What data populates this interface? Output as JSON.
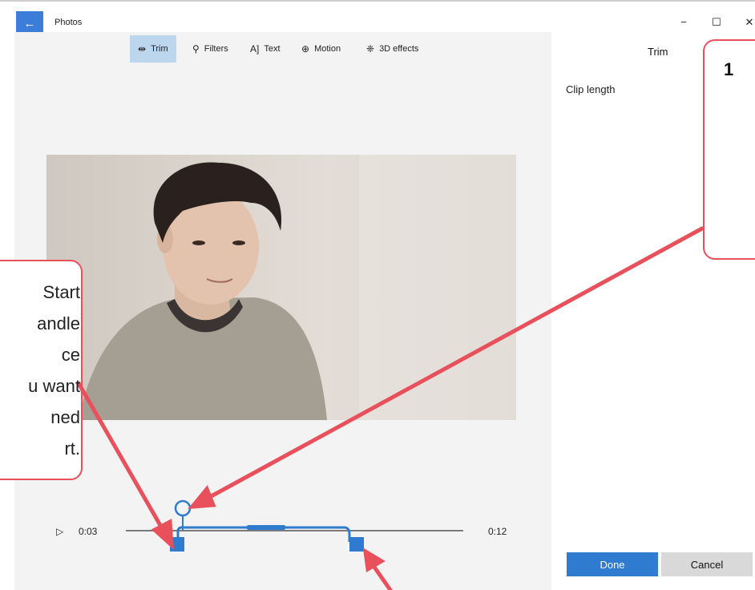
{
  "window": {
    "title": "Photos",
    "back_icon": "←",
    "minimize": "−",
    "maximize": "☐",
    "close": "✕"
  },
  "toolbar": {
    "items": [
      {
        "label": "Trim",
        "icon": "⇹",
        "active": true
      },
      {
        "label": "Filters",
        "icon": "⚲",
        "active": false
      },
      {
        "label": "Text",
        "icon": "A]",
        "active": false
      },
      {
        "label": "Motion",
        "icon": "⊕",
        "active": false
      },
      {
        "label": "3D effects",
        "icon": "❈",
        "active": false
      }
    ]
  },
  "panel": {
    "title": "Trim",
    "clip_length_label": "Clip length",
    "done_label": "Done",
    "cancel_label": "Cancel"
  },
  "timeline": {
    "play_icon": "▷",
    "start_time": "0:03",
    "end_time": "0:12",
    "start_fraction": 0.3,
    "end_fraction": 1.0,
    "playhead_fraction": 0.3
  },
  "callouts": {
    "right_number": "1",
    "left_lines": [
      "Start",
      "andle",
      "ce",
      "u want",
      "ned",
      "rt."
    ]
  },
  "colors": {
    "accent": "#2f7bcf",
    "annotation": "#e8505b",
    "toolbar_active": "#bcd6ee"
  }
}
